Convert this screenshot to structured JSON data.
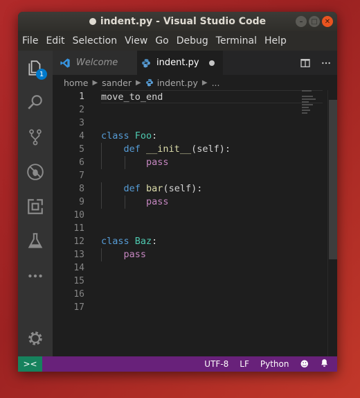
{
  "window": {
    "title": "indent.py - Visual Studio Code",
    "controls": [
      "–",
      "□",
      "✕"
    ]
  },
  "menu": [
    "File",
    "Edit",
    "Selection",
    "View",
    "Go",
    "Debug",
    "Terminal",
    "Help"
  ],
  "activity_bar": {
    "items": [
      {
        "icon": "files-icon",
        "badge": "1"
      },
      {
        "icon": "search-icon"
      },
      {
        "icon": "source-control-icon"
      },
      {
        "icon": "debug-icon"
      },
      {
        "icon": "extensions-icon"
      },
      {
        "icon": "test-flask-icon"
      },
      {
        "icon": "more-icon"
      }
    ],
    "bottom": {
      "icon": "gear-icon"
    }
  },
  "tabs": [
    {
      "label": "Welcome",
      "icon": "vscode-logo-icon",
      "active": false
    },
    {
      "label": "indent.py",
      "icon": "python-icon",
      "active": true,
      "dirty": true
    }
  ],
  "tab_actions": [
    "split-editor-icon",
    "more-actions-icon"
  ],
  "breadcrumb": {
    "parts": [
      "home",
      "sander",
      "indent.py",
      "..."
    ]
  },
  "editor": {
    "line_numbers": [
      "1",
      "2",
      "3",
      "4",
      "5",
      "6",
      "7",
      "8",
      "9",
      "10",
      "11",
      "12",
      "13",
      "14",
      "15",
      "16",
      "17"
    ],
    "current_line": 1
  },
  "status_bar": {
    "encoding": "UTF-8",
    "line_ending": "LF",
    "language": "Python",
    "colors": {
      "background": "#68217a",
      "remote": "#16825d"
    }
  },
  "colors": {
    "keyword": "#569cd6",
    "class_name": "#4ec9b0",
    "function": "#dcdcaa",
    "control": "#c586c0"
  }
}
